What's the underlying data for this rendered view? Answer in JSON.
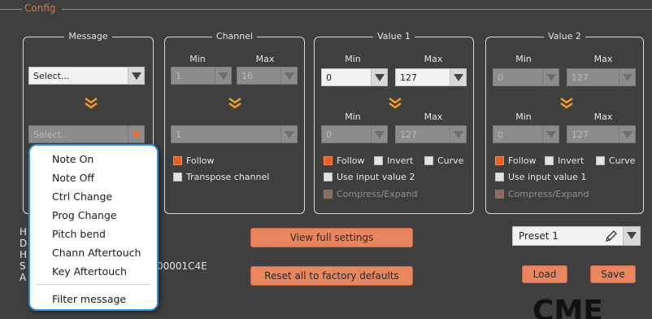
{
  "config": {
    "title": "Config"
  },
  "message": {
    "title": "Message",
    "select1": "Select...",
    "select2": "Select..."
  },
  "channel": {
    "title": "Channel",
    "min_label": "Min",
    "max_label": "Max",
    "min_value": "1",
    "max_value": "16",
    "target_value": "1",
    "follow_label": "Follow",
    "transpose_label": "Transpose channel"
  },
  "value1": {
    "title": "Value 1",
    "min_label": "Min",
    "max_label": "Max",
    "min_value": "0",
    "max_value": "127",
    "min2_label": "Min",
    "max2_label": "Max",
    "min2_value": "0",
    "max2_value": "127",
    "follow_label": "Follow",
    "invert_label": "Invert",
    "curve_label": "Curve",
    "use_input_label": "Use input value 2",
    "compress_label": "Compress/Expand"
  },
  "value2": {
    "title": "Value 2",
    "min_label": "Min",
    "max_label": "Max",
    "min_value": "0",
    "max_value": "127",
    "min2_label": "Min",
    "max2_label": "Max",
    "min2_value": "0",
    "max2_value": "127",
    "follow_label": "Follow",
    "invert_label": "Invert",
    "curve_label": "Curve",
    "use_input_label": "Use input value 1",
    "compress_label": "Compress/Expand"
  },
  "dropdown": {
    "items": [
      "Note On",
      "Note Off",
      "Ctrl Change",
      "Prog Change",
      "Pitch bend",
      "Chann Aftertouch",
      "Key Aftertouch"
    ],
    "filter_label": "Filter message"
  },
  "info": {
    "partial_letters": [
      "H",
      "D",
      "H",
      "S",
      "A"
    ],
    "serial_fragment": "00001C4E"
  },
  "buttons": {
    "view_full": "View full settings",
    "reset": "Reset all to factory defaults",
    "load": "Load",
    "save": "Save"
  },
  "preset": {
    "value": "Preset 1"
  },
  "logo": {
    "text": "CME"
  },
  "colors": {
    "accent": "#e8702a",
    "button": "#e9855f",
    "popup_border": "#2f8fd3"
  }
}
